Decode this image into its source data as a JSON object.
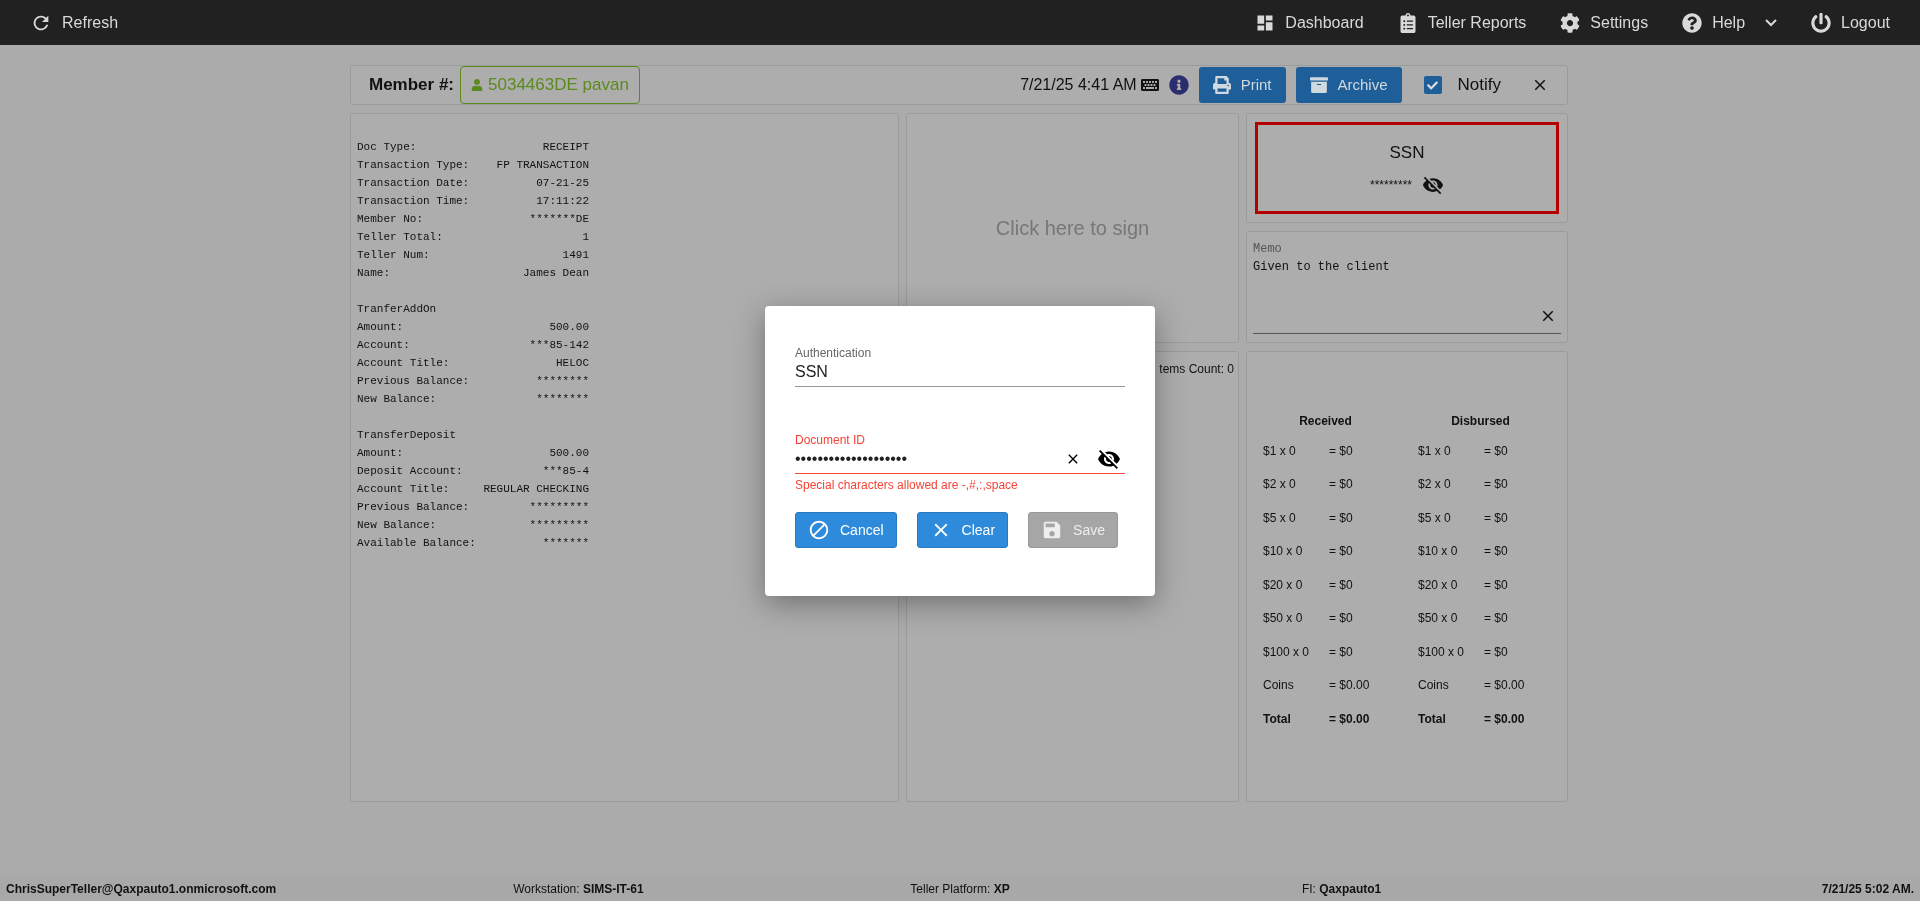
{
  "topbar": {
    "refresh": "Refresh",
    "items": [
      {
        "label": "Dashboard",
        "dropdown": false
      },
      {
        "label": "Teller Reports",
        "dropdown": false
      },
      {
        "label": "Settings",
        "dropdown": false
      },
      {
        "label": "Help",
        "dropdown": true
      },
      {
        "label": "Logout",
        "dropdown": false
      }
    ]
  },
  "header": {
    "member_label": "Member #:",
    "member_value": "5034463DE pavan",
    "datetime": "7/21/25 4:41 AM",
    "buttons": [
      "Print",
      "Archive"
    ],
    "notify": {
      "label": "Notify",
      "checked": true
    }
  },
  "receipt": {
    "sections": [
      {
        "rows": [
          {
            "label": "Doc Type:",
            "value": "RECEIPT"
          },
          {
            "label": "Transaction Type:",
            "value": "FP TRANSACTION"
          },
          {
            "label": "Transaction Date:",
            "value": "07-21-25"
          },
          {
            "label": "Transaction Time:",
            "value": "17:11:22"
          },
          {
            "label": "Member No:",
            "value": "*******DE"
          },
          {
            "label": "Teller Total:",
            "value": "1"
          },
          {
            "label": "Teller Num:",
            "value": "1491"
          },
          {
            "label": "Name:",
            "value": "James Dean"
          }
        ]
      },
      {
        "heading": "TranferAddOn",
        "rows": [
          {
            "label": "Amount:",
            "value": "500.00"
          },
          {
            "label": "Account:",
            "value": "***85-142"
          },
          {
            "label": "Account Title:",
            "value": "HELOC"
          },
          {
            "label": "Previous Balance:",
            "value": "********"
          },
          {
            "label": "New Balance:",
            "value": "********"
          }
        ]
      },
      {
        "heading": "TransferDeposit",
        "rows": [
          {
            "label": "Amount:",
            "value": "500.00"
          },
          {
            "label": "Deposit Account:",
            "value": "***85-4"
          },
          {
            "label": "Account Title:",
            "value": "REGULAR CHECKING"
          },
          {
            "label": "Previous Balance:",
            "value": "*********"
          },
          {
            "label": "New Balance:",
            "value": "*********"
          },
          {
            "label": "Available Balance:",
            "value": "*******"
          }
        ]
      }
    ]
  },
  "signature": {
    "prompt": "Click here to sign"
  },
  "items": {
    "count_text": "tems Count: 0"
  },
  "ssn_card": {
    "title": "SSN",
    "masked": "*********",
    "highlighted": true
  },
  "memo": {
    "label": "Memo",
    "value": "Given to the client"
  },
  "cash": {
    "columns": [
      {
        "heading": "Received",
        "rows": [
          {
            "kind": "line",
            "label": "$1 x 0",
            "value": "= $0"
          },
          {
            "kind": "line",
            "label": "$2 x 0",
            "value": "= $0"
          },
          {
            "kind": "line",
            "label": "$5 x 0",
            "value": "= $0"
          },
          {
            "kind": "line",
            "label": "$10 x 0",
            "value": "= $0"
          },
          {
            "kind": "line",
            "label": "$20 x 0",
            "value": "= $0"
          },
          {
            "kind": "line",
            "label": "$50 x 0",
            "value": "= $0"
          },
          {
            "kind": "line",
            "label": "$100 x 0",
            "value": "= $0"
          },
          {
            "kind": "line",
            "label": "Coins",
            "value": "= $0.00"
          },
          {
            "kind": "total",
            "label": "Total",
            "value": "= $0.00"
          }
        ]
      },
      {
        "heading": "Disbursed",
        "rows": [
          {
            "kind": "line",
            "label": "$1 x 0",
            "value": "= $0"
          },
          {
            "kind": "line",
            "label": "$2 x 0",
            "value": "= $0"
          },
          {
            "kind": "line",
            "label": "$5 x 0",
            "value": "= $0"
          },
          {
            "kind": "line",
            "label": "$10 x 0",
            "value": "= $0"
          },
          {
            "kind": "line",
            "label": "$20 x 0",
            "value": "= $0"
          },
          {
            "kind": "line",
            "label": "$50 x 0",
            "value": "= $0"
          },
          {
            "kind": "line",
            "label": "$100 x 0",
            "value": "= $0"
          },
          {
            "kind": "line",
            "label": "Coins",
            "value": "= $0.00"
          },
          {
            "kind": "total",
            "label": "Total",
            "value": "= $0.00"
          }
        ]
      }
    ]
  },
  "dialog": {
    "fields": [
      {
        "label": "Authentication",
        "value": "SSN",
        "error": false,
        "clearable": false,
        "reveal_toggle": false
      },
      {
        "label": "Document ID",
        "value": "••••••••••••••••••••",
        "error": true,
        "error_text": "Special characters allowed are -,#,:,space",
        "clearable": true,
        "reveal_toggle": true
      }
    ],
    "buttons": [
      {
        "label": "Cancel",
        "disabled": false
      },
      {
        "label": "Clear",
        "disabled": false
      },
      {
        "label": "Save",
        "disabled": true
      }
    ]
  },
  "status_bar": [
    "**ChrisSuperTeller@Qaxpauto1.onmicrosoft.com**",
    "Workstation: **SIMS-IT-61**",
    "Teller Platform: **XP**",
    "FI: **Qaxpauto1**",
    "**7/21/25 5:02 AM.**"
  ]
}
